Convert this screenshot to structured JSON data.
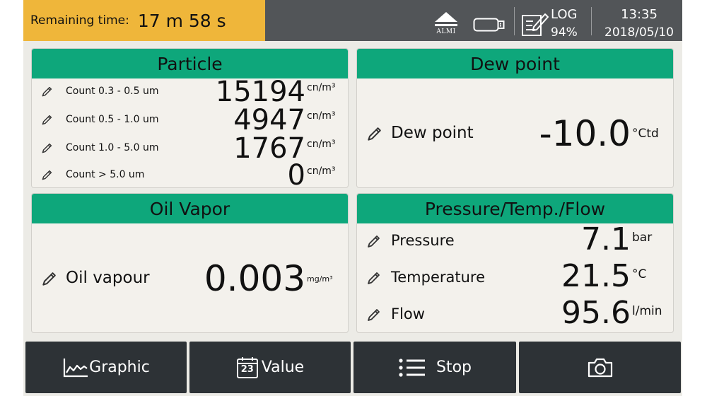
{
  "status_bar": {
    "remaining_label": "Remaining time:",
    "remaining_value": "17 m 58 s",
    "almi_label": "ALMI",
    "log_label": "LOG",
    "log_percent": "94%",
    "time": "13:35",
    "date": "2018/05/10"
  },
  "panels": {
    "particle": {
      "title": "Particle",
      "rows": [
        {
          "label": "Count 0.3 - 0.5 um",
          "value": "15194",
          "unit": "cn/m³"
        },
        {
          "label": "Count 0.5 - 1.0 um",
          "value": "4947",
          "unit": "cn/m³"
        },
        {
          "label": "Count 1.0 - 5.0 um",
          "value": "1767",
          "unit": "cn/m³"
        },
        {
          "label": "Count > 5.0 um",
          "value": "0",
          "unit": "cn/m³"
        }
      ]
    },
    "dew_point": {
      "title": "Dew point",
      "label": "Dew point",
      "value": "-10.0",
      "unit": "°Ctd"
    },
    "oil_vapor": {
      "title": "Oil Vapor",
      "label": "Oil vapour",
      "value": "0.003",
      "unit": "mg/m³"
    },
    "ptf": {
      "title": "Pressure/Temp./Flow",
      "rows": [
        {
          "label": "Pressure",
          "value": "7.1",
          "unit": "bar"
        },
        {
          "label": "Temperature",
          "value": "21.5",
          "unit": "°C"
        },
        {
          "label": "Flow",
          "value": "95.6",
          "unit": "l/min"
        }
      ]
    }
  },
  "buttons": {
    "graphic": "Graphic",
    "value": "Value",
    "value_icon_text": "23",
    "stop": "Stop"
  },
  "icons": {
    "edit": "pencil-icon",
    "usb": "usb-stick-icon",
    "log": "log-edit-icon",
    "graphic": "line-chart-icon",
    "value": "calendar-icon",
    "stop": "list-icon",
    "camera": "camera-icon"
  },
  "colors": {
    "status_bar": "#525558",
    "remaining_bg": "#efb63a",
    "panel_header": "#0ea77b",
    "panel_bg": "#f3f1ec",
    "button_bg": "#2d3236"
  }
}
